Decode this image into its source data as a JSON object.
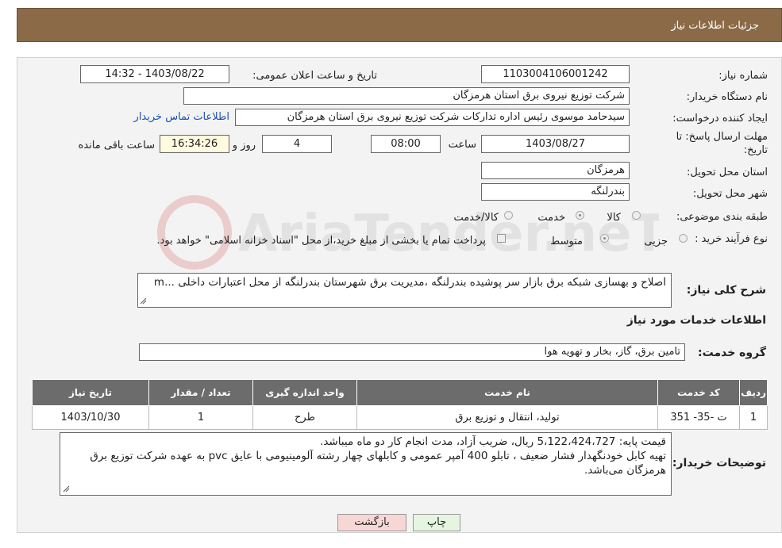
{
  "header": {
    "title": "جزئیات اطلاعات نیاز"
  },
  "form": {
    "need_number_label": "شماره نیاز:",
    "need_number": "1103004106001242",
    "announce_label": "تاریخ و ساعت اعلان عمومی:",
    "announce_value": "1403/08/22 - 14:32",
    "buyer_org_label": "نام دستگاه خریدار:",
    "buyer_org": "شرکت توزیع نیروی برق استان هرمزگان",
    "creator_label": "ایجاد کننده درخواست:",
    "creator": "سیدحامد موسوی رئیس اداره تدارکات شرکت توزیع نیروی برق استان هرمزگان",
    "contact_link": "اطلاعات تماس خریدار",
    "deadline_label_1": "مهلت ارسال پاسخ: تا",
    "deadline_label_2": "تاریخ:",
    "deadline_date": "1403/08/27",
    "time_label": "ساعت",
    "deadline_time": "08:00",
    "days_value": "4",
    "days_label": "روز و",
    "remaining_time": "16:34:26",
    "remaining_label": "ساعت باقی مانده",
    "province_label": "استان محل تحویل:",
    "province": "هرمزگان",
    "city_label": "شهر محل تحویل:",
    "city": "بندرلنگه",
    "category_label": "طبقه بندی موضوعی:",
    "category_options": [
      "کالا",
      "خدمت",
      "کالا/خدمت"
    ],
    "category_selected": "خدمت",
    "process_label": "نوع فرآیند خرید :",
    "process_options": [
      "جزیی",
      "متوسط"
    ],
    "process_selected": "متوسط",
    "payment_note": "پرداخت تمام یا بخشی از مبلغ خرید،از محل \"اسناد خزانه اسلامی\" خواهد بود."
  },
  "description": {
    "label": "شرح کلی نیاز:",
    "text": "اصلاح و بهسازی شبکه برق بازار سر پوشیده بندرلنگه ،مدیریت برق شهرستان بندرلنگه از محل اعتبارات داخلی ...m"
  },
  "services": {
    "section_title": "اطلاعات خدمات مورد نیاز",
    "group_label": "گروه خدمت:",
    "group_value": "تامین برق، گاز، بخار و تهویه هوا",
    "columns": [
      "ردیف",
      "کد خدمت",
      "نام خدمت",
      "واحد اندازه گیری",
      "تعداد / مقدار",
      "تاریخ نیاز"
    ],
    "rows": [
      [
        "1",
        "ت -35- 351",
        "تولید، انتقال و توزیع برق",
        "طرح",
        "1",
        "1403/10/30"
      ]
    ]
  },
  "buyer_notes": {
    "label": "توضیحات خریدار:",
    "line1": "قیمت پایه: 5،122،424،727 ریال، ضریب آزاد، مدت انجام کار دو ماه میباشد.",
    "line2": "تهیه کابل خودنگهدار فشار ضعیف ، تابلو 400 آمپر عمومی و کابلهای چهار رشته آلومینیومی با عایق pvc  به عهده شرکت توزیع برق هرمزگان می‌باشد."
  },
  "buttons": {
    "print": "چاپ",
    "back": "بازگشت"
  },
  "watermark": {
    "text": "AriaTender.neT"
  },
  "colors": {
    "header_bg": "#8b6a48",
    "link": "#1a4fb4",
    "back_bg": "#f7d6d6",
    "print_bg": "#e6f5e0"
  }
}
